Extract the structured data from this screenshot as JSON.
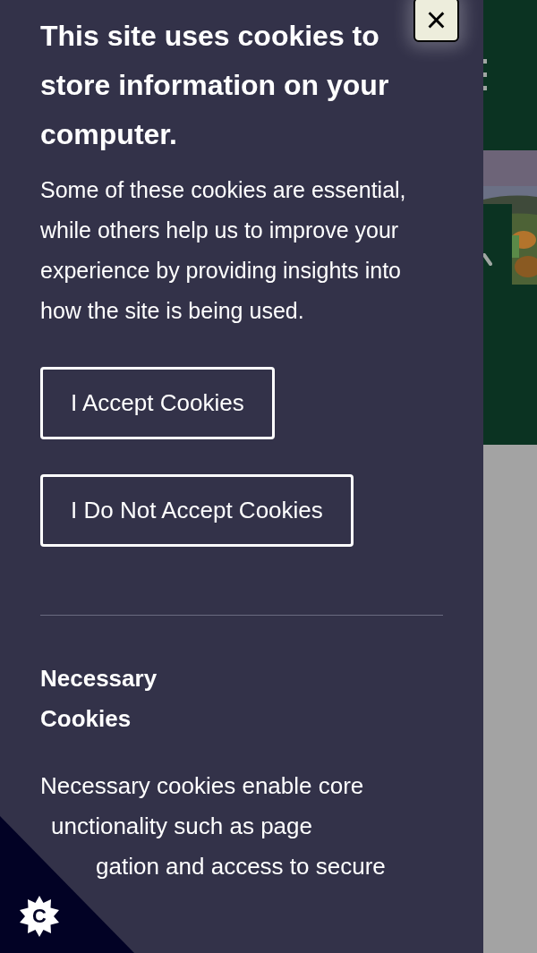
{
  "close_button": {
    "label": "×"
  },
  "banner": {
    "title": "This site uses cookies to store information on your computer.",
    "intro": "Some of these cookies are essential, while others help us to improve your experience by providing insights into how the site is being used.",
    "buttons": [
      {
        "label": "I Accept Cookies"
      },
      {
        "label": "I Do Not Accept Cookies"
      }
    ],
    "sections": [
      {
        "title": "Necessary Cookies",
        "lines": [
          "Necessary cookies enable core",
          "unctionality such as page",
          "gation and access to secure"
        ]
      }
    ]
  },
  "cookie_badge": {
    "label": "C"
  }
}
